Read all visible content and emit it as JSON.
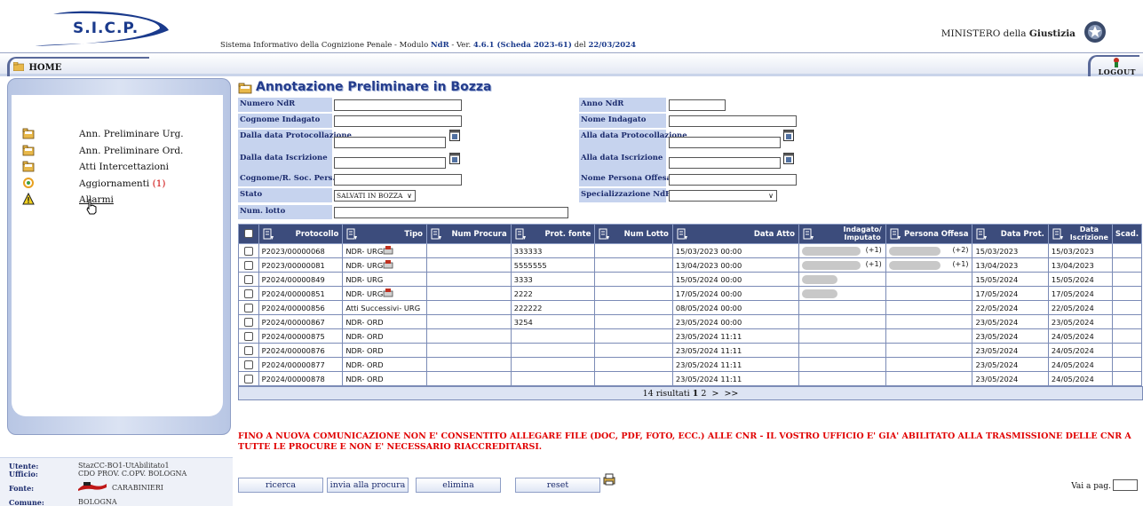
{
  "header": {
    "logo_text": "S.I.C.P.",
    "app_info_prefix": "Sistema Informativo della Cognizione Penale - Modulo ",
    "app_info_module": "NdR",
    "app_info_mid": " - Ver. ",
    "app_info_version": "4.6.1 (Scheda 2023-61)",
    "app_info_del": " del ",
    "app_info_date": "22/03/2024",
    "ministry_prefix": "MINISTERO della ",
    "ministry_bold": "Giustizia"
  },
  "nav": {
    "home_label": "HOME",
    "logout_label": "LOGOUT"
  },
  "sidebar": {
    "items": [
      {
        "label": "Ann. Preliminare Urg.",
        "icon": "folder-icon"
      },
      {
        "label": "Ann. Preliminare Ord.",
        "icon": "folder-icon"
      },
      {
        "label": "Atti Intercettazioni",
        "icon": "folder-icon"
      },
      {
        "label": "Aggiornamenti",
        "count": "(1)",
        "icon": "refresh-icon"
      },
      {
        "label": "Allarmi",
        "icon": "warning-icon"
      }
    ]
  },
  "user": {
    "utente_label": "Utente:",
    "utente_value": "StazCC-BO1-UtAbilitato1",
    "ufficio_label": "Ufficio:",
    "ufficio_value": "CDO PROV. C.OPV. BOLOGNA",
    "fonte_label": "Fonte:",
    "fonte_value": "CARABINIERI",
    "comune_label": "Comune:",
    "comune_value": "BOLOGNA"
  },
  "page": {
    "title": "Annotazione Preliminare in Bozza"
  },
  "form": {
    "numero_ndr": {
      "label": "Numero NdR",
      "value": ""
    },
    "anno_ndr": {
      "label": "Anno NdR",
      "value": ""
    },
    "cognome_indagato": {
      "label": "Cognome Indagato",
      "value": ""
    },
    "nome_indagato": {
      "label": "Nome Indagato",
      "value": ""
    },
    "dalla_data_prot": {
      "label": "Dalla data Protocollazione",
      "value": ""
    },
    "alla_data_prot": {
      "label": "Alla data Protocollazione",
      "value": ""
    },
    "dalla_data_iscr": {
      "label": "Dalla data Iscrizione",
      "value": ""
    },
    "alla_data_iscr": {
      "label": "Alla data Iscrizione",
      "value": ""
    },
    "cognome_offeso": {
      "label": "Cognome/R. Soc. Pers. Off.",
      "value": ""
    },
    "nome_offeso": {
      "label": "Nome Persona Offesa",
      "value": ""
    },
    "stato": {
      "label": "Stato",
      "value": "SALVATI IN BOZZA"
    },
    "specializzazione": {
      "label": "Specializzazione NdR",
      "value": ""
    },
    "num_lotto": {
      "label": "Num. lotto",
      "value": ""
    }
  },
  "table": {
    "headers": {
      "protocollo": "Protocollo",
      "tipo": "Tipo",
      "num_procura": "Num Procura",
      "prot_fonte": "Prot. fonte",
      "num_lotto": "Num Lotto",
      "data_atto": "Data Atto",
      "indagato_1": "Indagato/",
      "indagato_2": "Imputato",
      "persona_offesa": "Persona Offesa",
      "data_prot": "Data Prot.",
      "data_iscr_1": "Data",
      "data_iscr_2": "Iscrizione",
      "scad": "Scad."
    },
    "rows": [
      {
        "protocollo": "P2023/00000068",
        "tipo": "NDR- URG",
        "doc": true,
        "num_procura": "",
        "prot_fonte": "333333",
        "num_lotto": "",
        "data_atto": "15/03/2023 00:00",
        "indagato_blur": true,
        "indagato_plus": "(+1)",
        "offesa_blur": true,
        "offesa_plus": "(+2)",
        "data_prot": "15/03/2023",
        "data_iscr": "15/03/2023",
        "scad": ""
      },
      {
        "protocollo": "P2023/00000081",
        "tipo": "NDR- URG",
        "doc": true,
        "num_procura": "",
        "prot_fonte": "5555555",
        "num_lotto": "",
        "data_atto": "13/04/2023 00:00",
        "indagato_blur": true,
        "indagato_plus": "(+1)",
        "offesa_blur": true,
        "offesa_plus": "(+1)",
        "data_prot": "13/04/2023",
        "data_iscr": "13/04/2023",
        "scad": ""
      },
      {
        "protocollo": "P2024/00000849",
        "tipo": "NDR- URG",
        "doc": false,
        "num_procura": "",
        "prot_fonte": "3333",
        "num_lotto": "",
        "data_atto": "15/05/2024 00:00",
        "indagato_blur": true,
        "indagato_plus": "",
        "offesa_blur": false,
        "offesa_plus": "",
        "data_prot": "15/05/2024",
        "data_iscr": "15/05/2024",
        "scad": ""
      },
      {
        "protocollo": "P2024/00000851",
        "tipo": "NDR- URG",
        "doc": true,
        "num_procura": "",
        "prot_fonte": "2222",
        "num_lotto": "",
        "data_atto": "17/05/2024 00:00",
        "indagato_blur": true,
        "indagato_plus": "",
        "offesa_blur": false,
        "offesa_plus": "",
        "data_prot": "17/05/2024",
        "data_iscr": "17/05/2024",
        "scad": ""
      },
      {
        "protocollo": "P2024/00000856",
        "tipo": "Atti Successivi- URG",
        "doc": false,
        "num_procura": "",
        "prot_fonte": "222222",
        "num_lotto": "",
        "data_atto": "08/05/2024 00:00",
        "indagato_blur": false,
        "indagato_plus": "",
        "offesa_blur": false,
        "offesa_plus": "",
        "data_prot": "22/05/2024",
        "data_iscr": "22/05/2024",
        "scad": ""
      },
      {
        "protocollo": "P2024/00000867",
        "tipo": "NDR- ORD",
        "doc": false,
        "num_procura": "",
        "prot_fonte": "3254",
        "num_lotto": "",
        "data_atto": "23/05/2024 00:00",
        "indagato_blur": false,
        "indagato_plus": "",
        "offesa_blur": false,
        "offesa_plus": "",
        "data_prot": "23/05/2024",
        "data_iscr": "23/05/2024",
        "scad": ""
      },
      {
        "protocollo": "P2024/00000875",
        "tipo": "NDR- ORD",
        "doc": false,
        "num_procura": "",
        "prot_fonte": "",
        "num_lotto": "",
        "data_atto": "23/05/2024 11:11",
        "indagato_blur": false,
        "indagato_plus": "",
        "offesa_blur": false,
        "offesa_plus": "",
        "data_prot": "23/05/2024",
        "data_iscr": "24/05/2024",
        "scad": ""
      },
      {
        "protocollo": "P2024/00000876",
        "tipo": "NDR- ORD",
        "doc": false,
        "num_procura": "",
        "prot_fonte": "",
        "num_lotto": "",
        "data_atto": "23/05/2024 11:11",
        "indagato_blur": false,
        "indagato_plus": "",
        "offesa_blur": false,
        "offesa_plus": "",
        "data_prot": "23/05/2024",
        "data_iscr": "24/05/2024",
        "scad": ""
      },
      {
        "protocollo": "P2024/00000877",
        "tipo": "NDR- ORD",
        "doc": false,
        "num_procura": "",
        "prot_fonte": "",
        "num_lotto": "",
        "data_atto": "23/05/2024 11:11",
        "indagato_blur": false,
        "indagato_plus": "",
        "offesa_blur": false,
        "offesa_plus": "",
        "data_prot": "23/05/2024",
        "data_iscr": "24/05/2024",
        "scad": ""
      },
      {
        "protocollo": "P2024/00000878",
        "tipo": "NDR- ORD",
        "doc": false,
        "num_procura": "",
        "prot_fonte": "",
        "num_lotto": "",
        "data_atto": "23/05/2024 11:11",
        "indagato_blur": false,
        "indagato_plus": "",
        "offesa_blur": false,
        "offesa_plus": "",
        "data_prot": "23/05/2024",
        "data_iscr": "24/05/2024",
        "scad": ""
      }
    ],
    "pager": {
      "results_text": "14 risultati",
      "page_1": "1",
      "page_2": "2",
      "next": ">",
      "last": ">>"
    }
  },
  "warning": "FINO A NUOVA COMUNICAZIONE NON E' CONSENTITO ALLEGARE FILE (DOC, PDF, FOTO, ECC.) ALLE CNR - IL VOSTRO UFFICIO E' GIA' ABILITATO ALLA TRASMISSIONE DELLE CNR A TUTTE LE PROCURE E NON E' NECESSARIO RIACCREDITARSI.",
  "buttons": {
    "ricerca": "ricerca",
    "invia": "invia alla procura",
    "elimina": "elimina",
    "reset": "reset"
  },
  "vai_a_pag": "Vai a pag.",
  "colors": {
    "header_dark": "#3c4c7c",
    "label_bg": "#c6d3ee",
    "warning": "#e00000",
    "title": "#243c8c"
  }
}
